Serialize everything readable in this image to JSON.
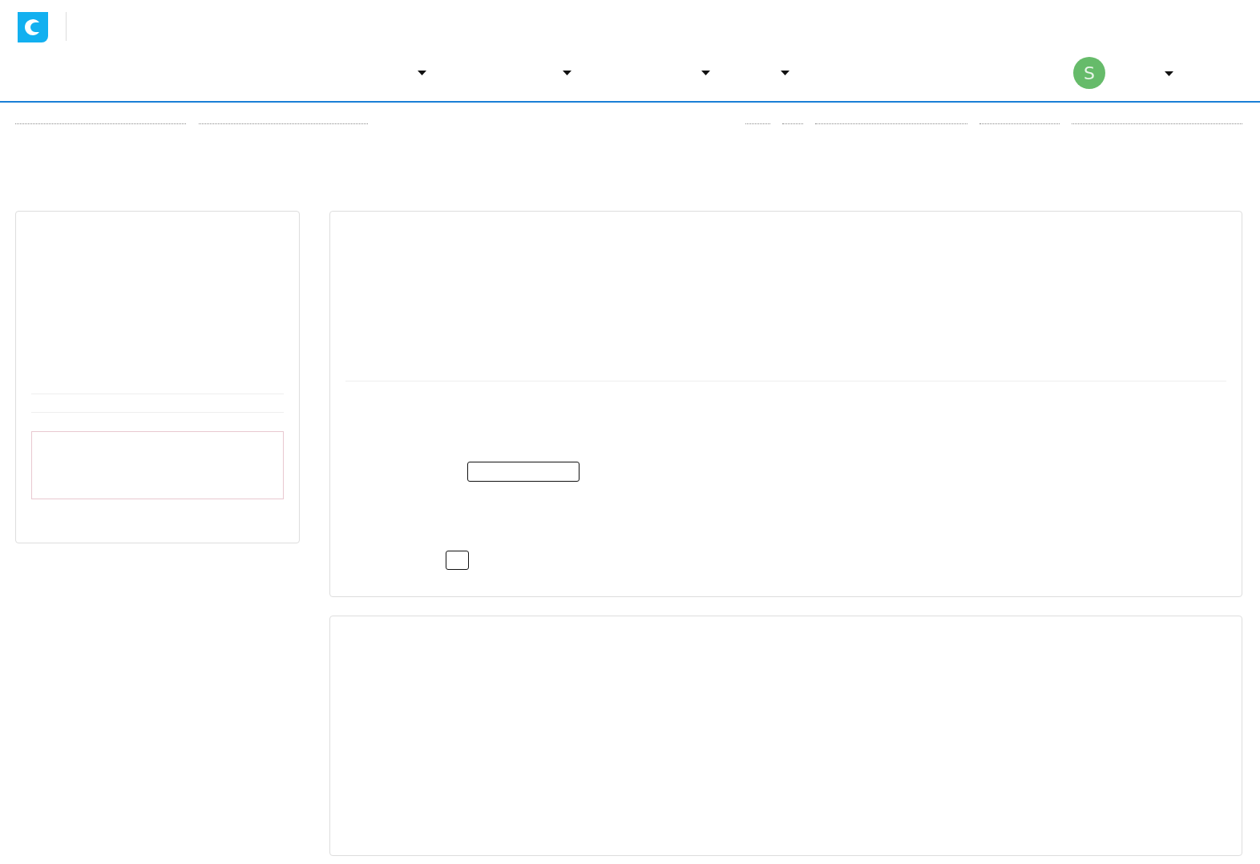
{
  "header": {
    "menus": [
      {
        "kind": "dropdown"
      },
      {
        "kind": "dropdown"
      },
      {
        "kind": "dropdown"
      },
      {
        "kind": "dropdown"
      }
    ],
    "user": {
      "initial": "S",
      "color": "#66bb6a"
    }
  },
  "form": {
    "fields": [
      {
        "kind": "text"
      },
      {
        "kind": "checkbox",
        "checked": false
      }
    ]
  }
}
